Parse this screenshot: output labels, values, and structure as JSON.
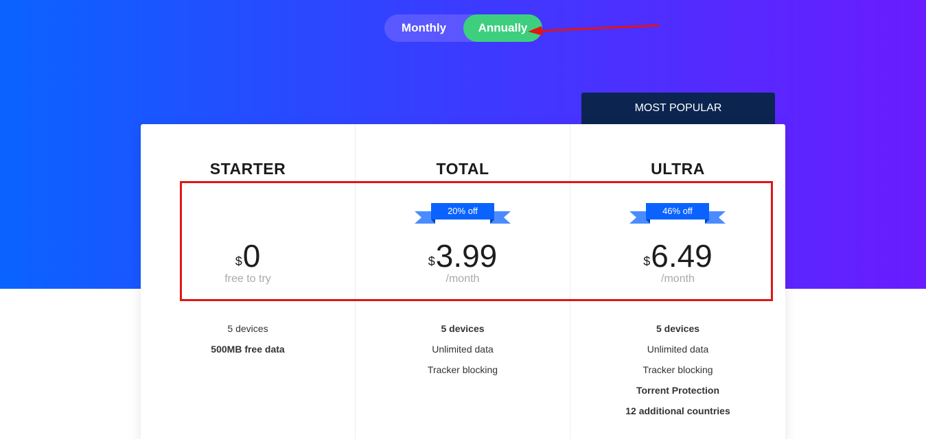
{
  "billing_toggle": {
    "monthly_label": "Monthly",
    "annually_label": "Annually",
    "selected": "Annually"
  },
  "popular_badge": "MOST POPULAR",
  "plans": [
    {
      "name": "STARTER",
      "discount": "",
      "currency": "$",
      "price": "0",
      "subtext": "free to try",
      "features": [
        {
          "text": "5 devices",
          "bold": false
        },
        {
          "text": "500MB free data",
          "bold": true
        }
      ]
    },
    {
      "name": "TOTAL",
      "discount": "20% off",
      "currency": "$",
      "price": "3.99",
      "subtext": "/month",
      "features": [
        {
          "text": "5 devices",
          "bold": true
        },
        {
          "text": "Unlimited data",
          "bold": false
        },
        {
          "text": "Tracker blocking",
          "bold": false
        }
      ]
    },
    {
      "name": "ULTRA",
      "discount": "46% off",
      "currency": "$",
      "price": "6.49",
      "subtext": "/month",
      "features": [
        {
          "text": "5 devices",
          "bold": true
        },
        {
          "text": "Unlimited data",
          "bold": false
        },
        {
          "text": "Tracker blocking",
          "bold": false
        },
        {
          "text": "Torrent Protection",
          "bold": true
        },
        {
          "text": "12 additional countries",
          "bold": true
        }
      ]
    }
  ],
  "colors": {
    "toggle_active": "#3ecf7e",
    "popular_tab": "#0b2550",
    "ribbon": "#0a63ff",
    "annotation": "#e31414"
  }
}
